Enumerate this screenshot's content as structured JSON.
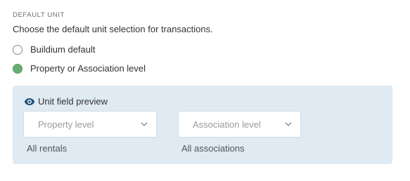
{
  "section": {
    "label": "DEFAULT UNIT",
    "description": "Choose the default unit selection for transactions."
  },
  "options": [
    {
      "label": "Buildium default",
      "checked": false
    },
    {
      "label": "Property or Association level",
      "checked": true
    }
  ],
  "preview": {
    "title": "Unit field preview",
    "icon": "eye-icon",
    "selects": [
      {
        "placeholder": "Property level",
        "caption": "All rentals"
      },
      {
        "placeholder": "Association level",
        "caption": "All associations"
      }
    ]
  },
  "colors": {
    "radio_checked": "#6aae72",
    "panel_bg": "#dfeaf2",
    "icon": "#1d4f7a"
  }
}
